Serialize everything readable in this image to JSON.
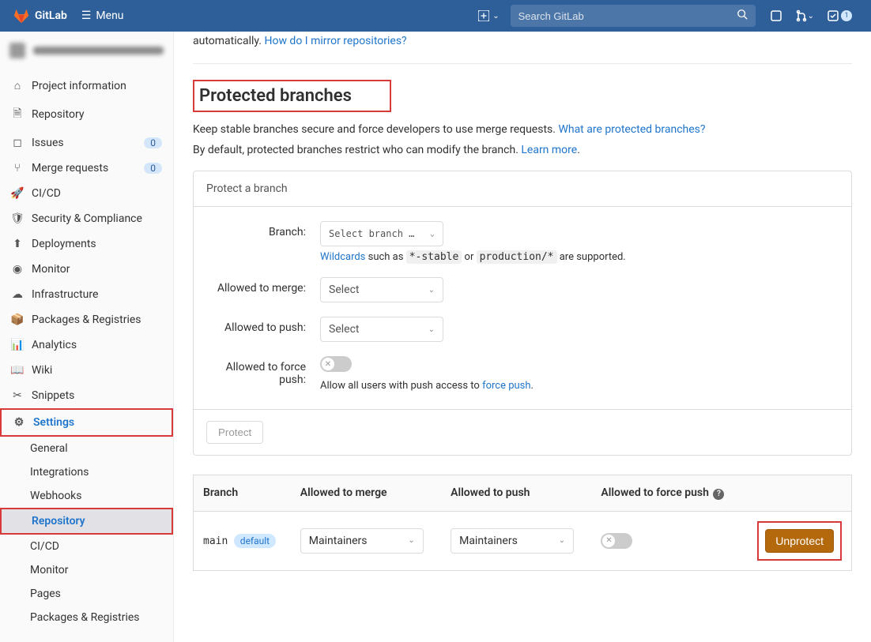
{
  "topnav": {
    "brand": "GitLab",
    "menu_label": "Menu",
    "search_placeholder": "Search GitLab",
    "todo_count": "1"
  },
  "sidebar": {
    "items": [
      {
        "label": "Project information"
      },
      {
        "label": "Repository"
      },
      {
        "label": "Issues",
        "count": "0"
      },
      {
        "label": "Merge requests",
        "count": "0"
      },
      {
        "label": "CI/CD"
      },
      {
        "label": "Security & Compliance"
      },
      {
        "label": "Deployments"
      },
      {
        "label": "Monitor"
      },
      {
        "label": "Infrastructure"
      },
      {
        "label": "Packages & Registries"
      },
      {
        "label": "Analytics"
      },
      {
        "label": "Wiki"
      },
      {
        "label": "Snippets"
      },
      {
        "label": "Settings"
      }
    ],
    "settings_sub": [
      {
        "label": "General"
      },
      {
        "label": "Integrations"
      },
      {
        "label": "Webhooks"
      },
      {
        "label": "Repository"
      },
      {
        "label": "CI/CD"
      },
      {
        "label": "Monitor"
      },
      {
        "label": "Pages"
      },
      {
        "label": "Packages & Registries"
      }
    ]
  },
  "main": {
    "partial_text": "automatically.",
    "partial_link": "How do I mirror repositories?",
    "heading": "Protected branches",
    "desc1_a": "Keep stable branches secure and force developers to use merge requests. ",
    "desc1_link": "What are protected branches?",
    "desc2_a": "By default, protected branches restrict who can modify the branch. ",
    "desc2_link": "Learn more",
    "desc2_b": ".",
    "panel_header": "Protect a branch",
    "form": {
      "branch_label": "Branch:",
      "branch_placeholder": "Select branch …",
      "wildcards_link": "Wildcards",
      "wildcards_mid": " such as ",
      "wild1": "*-stable",
      "wild_or": " or ",
      "wild2": "production/*",
      "wild_end": " are supported.",
      "merge_label": "Allowed to merge:",
      "merge_sel": "Select",
      "push_label": "Allowed to push:",
      "push_sel": "Select",
      "force_label": "Allowed to force push:",
      "force_hint_a": "Allow all users with push access to ",
      "force_link": "force push",
      "force_hint_b": "."
    },
    "protect_btn": "Protect",
    "table": {
      "h1": "Branch",
      "h2": "Allowed to merge",
      "h3": "Allowed to push",
      "h4": "Allowed to force push",
      "row": {
        "branch": "main",
        "default_badge": "default",
        "merge": "Maintainers",
        "push": "Maintainers",
        "unprotect": "Unprotect"
      }
    }
  }
}
